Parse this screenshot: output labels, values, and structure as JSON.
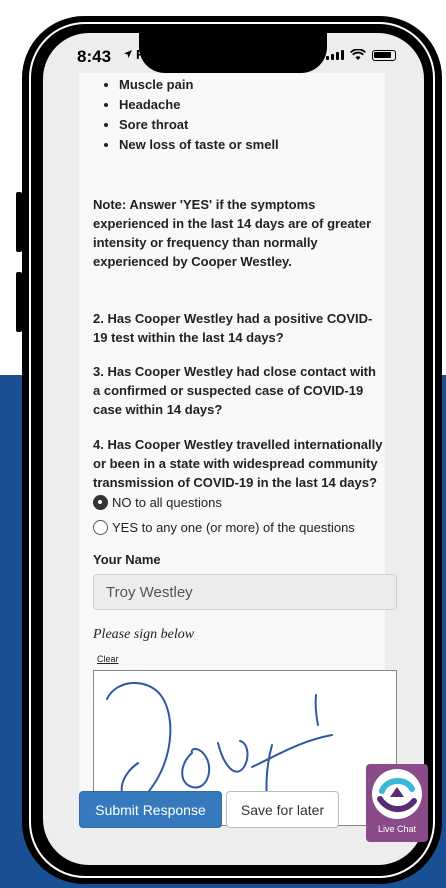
{
  "status_bar": {
    "time": "8:43",
    "partial_text": "F"
  },
  "symptoms": [
    "Muscle pain",
    "Headache",
    "Sore throat",
    "New loss of taste or smell"
  ],
  "note": "Note: Answer 'YES' if the symptoms experienced in the last 14 days are of greater intensity or frequency than normally experienced by Cooper Westley.",
  "questions": {
    "q2": "2.  Has Cooper Westley had a positive COVID-19 test within the last 14 days?",
    "q3": "3. Has Cooper Westley had close contact with a confirmed or suspected case of COVID-19 case within 14 days?",
    "q4": "4. Has Cooper Westley travelled internationally or been in a state with widespread community transmission of COVID-19 in the last 14 days?"
  },
  "answers": {
    "no_label": "NO to all questions",
    "yes_label": "YES to any one (or more) of the questions",
    "selected": "no"
  },
  "name_field": {
    "label": "Your Name",
    "value": "Troy Westley"
  },
  "signature": {
    "prompt": "Please sign below",
    "clear_label": "Clear"
  },
  "buttons": {
    "submit": "Submit Response",
    "save": "Save for later"
  },
  "live_chat": {
    "label": "Live Chat",
    "color": "#8a4b8a"
  },
  "colors": {
    "background_blue": "#1a4f93",
    "primary_button": "#3779bd"
  }
}
